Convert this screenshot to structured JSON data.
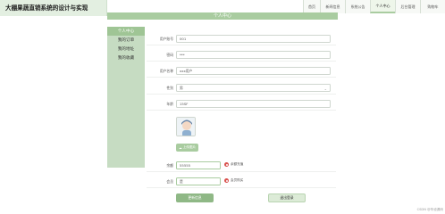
{
  "app": {
    "title": "大棚果蔬直销系统的设计与实现"
  },
  "nav": {
    "tabs": [
      {
        "label": "首页",
        "active": false
      },
      {
        "label": "新闻信息",
        "active": false
      },
      {
        "label": "系统公告",
        "active": false
      },
      {
        "label": "个人中心",
        "active": true
      },
      {
        "label": "后台管理",
        "active": false
      },
      {
        "label": "购物车",
        "active": false
      }
    ]
  },
  "page": {
    "header": "个人中心"
  },
  "sidebar": {
    "items": [
      {
        "label": "个人中心",
        "active": true
      },
      {
        "label": "我的订单",
        "active": false
      },
      {
        "label": "我的地址",
        "active": false
      },
      {
        "label": "我的收藏",
        "active": false
      }
    ]
  },
  "form": {
    "account": {
      "label": "用户账号",
      "value": "001"
    },
    "password": {
      "label": "密码",
      "value": "***"
    },
    "name": {
      "label": "用户名称",
      "value": "xxx用户"
    },
    "gender": {
      "label": "性别",
      "value": "男"
    },
    "age": {
      "label": "年龄",
      "value": "15SF"
    },
    "upload": {
      "label": "上传图片"
    },
    "balance": {
      "label": "余额",
      "value": "55555",
      "option": "余额充值"
    },
    "vip": {
      "label": "会员",
      "value": "是",
      "option": "会员购买"
    }
  },
  "buttons": {
    "update": "更新信息",
    "logout": "退出登录"
  },
  "watermark": "CSDN @毕设源码"
}
